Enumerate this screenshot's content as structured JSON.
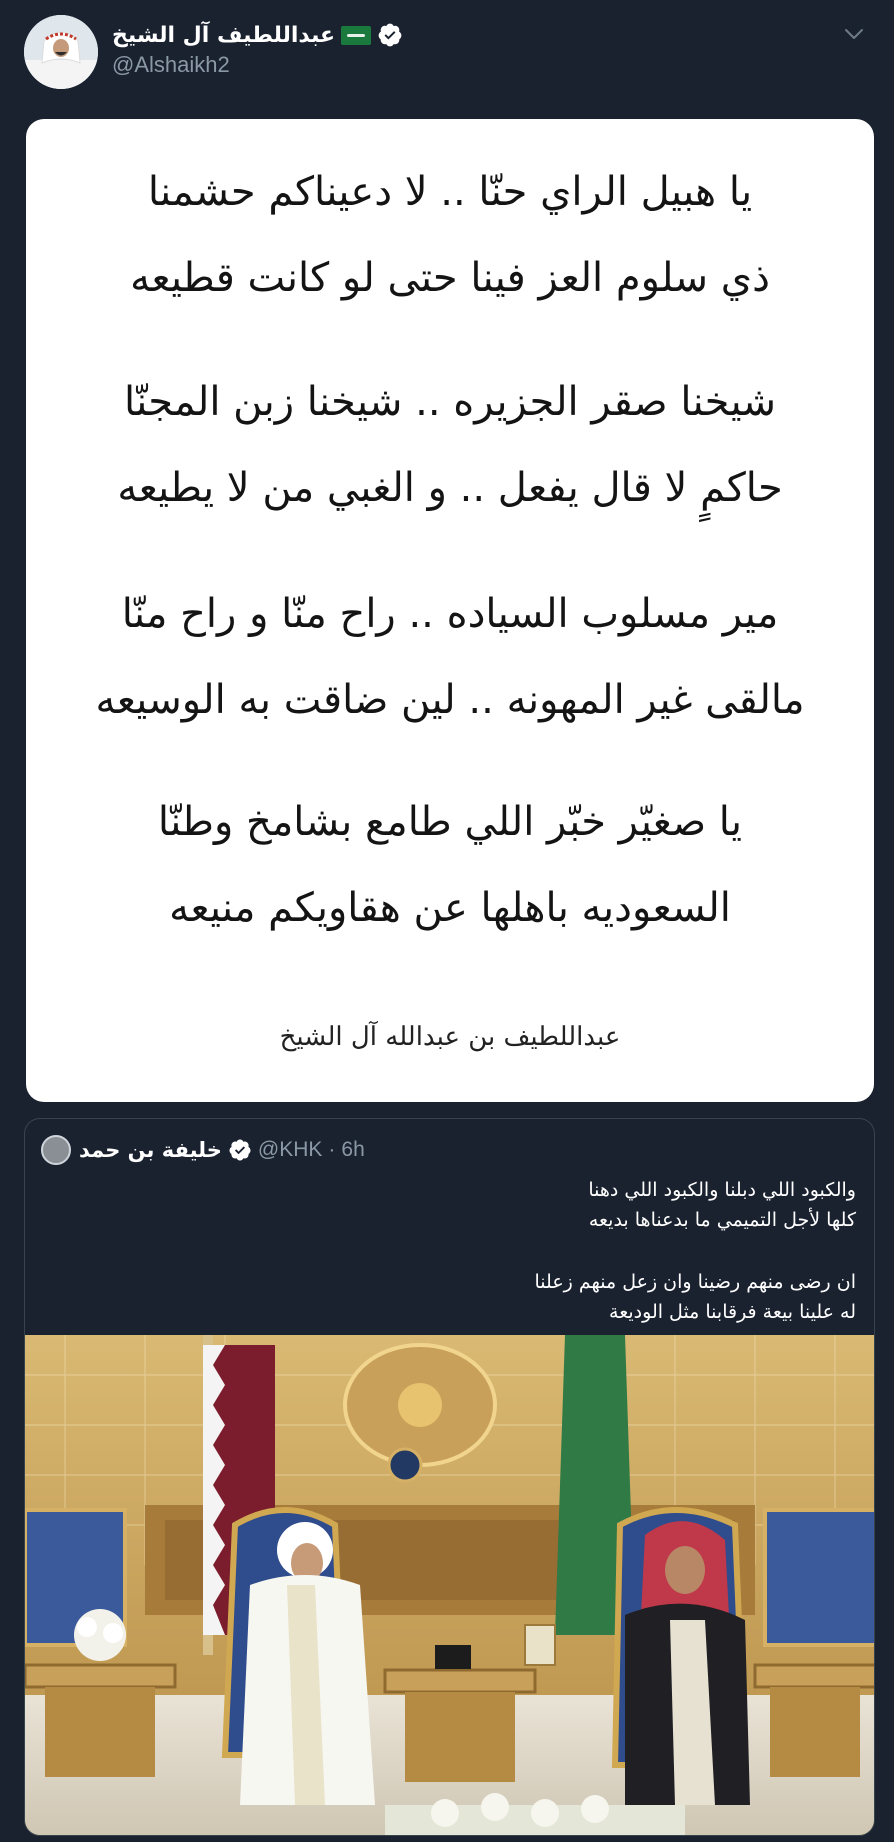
{
  "tweet": {
    "author_name": "عبداللطيف آل الشيخ",
    "author_handle": "@Alshaikh2",
    "icons": [
      "saudi-flag-icon",
      "verified-badge-icon",
      "chevron-down-icon"
    ],
    "poem_image": {
      "stanzas": [
        [
          "يا هبيل الراي حنّا .. لا دعيناكم حشمنا",
          "ذي سلوم العز فينا حتى لو كانت قطيعه"
        ],
        [
          "شيخنا صقر الجزيره .. شيخنا زبن المجنّا",
          "حاكمٍ لا قال يفعل .. و الغبي من لا يطيعه"
        ],
        [
          "مير مسلوب السياده .. راح منّا و راح منّا",
          "مالقى غير المهونه .. لين ضاقت به الوسيعه"
        ],
        [
          "يا صغيّر خبّر اللي طامع بشامخ وطنّا",
          "السعوديه باهلها عن هقاويكم منيعه"
        ]
      ],
      "signature": "عبداللطيف بن عبدالله آل الشيخ"
    }
  },
  "quoted_tweet": {
    "author_name": "خليفة بن حمد",
    "author_handle": "@KHK",
    "separator": "·",
    "time": "6h",
    "body_lines": [
      "والكبود اللي دبلنا والكبود اللي دهنا",
      "كلها لأجل التميمي ما بدعناها بديعه",
      "",
      "ان رضى منهم رضينا وان زعل منهم زعلنا",
      "له علينا بيعة فرقابنا مثل الوديعة"
    ],
    "media_alt": "photo"
  },
  "colors": {
    "background": "#1a2230",
    "text_primary": "#ffffff",
    "text_secondary": "#8b98a5",
    "verified": "#ffffff",
    "card_border": "#38444d"
  }
}
